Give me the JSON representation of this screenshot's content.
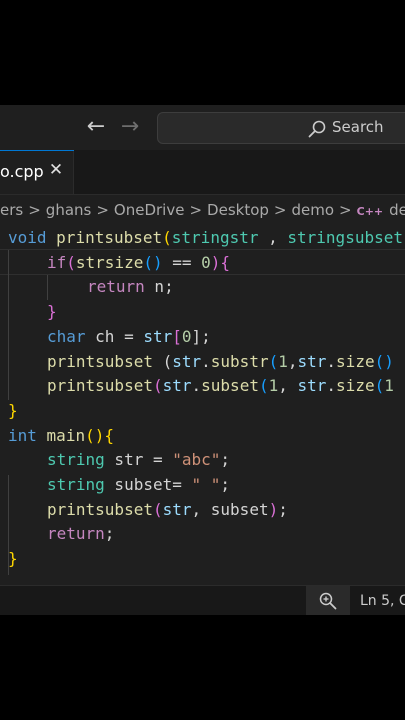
{
  "titlebar": {
    "back_icon": "arrow-left-icon",
    "forward_icon": "arrow-right-icon",
    "search_label": "Search",
    "back_glyph": "←",
    "forward_glyph": "→"
  },
  "tab": {
    "label": "o.cpp",
    "close_glyph": "✕"
  },
  "breadcrumb": {
    "parts": [
      "ers",
      "ghans",
      "OneDrive",
      "Desktop",
      "demo",
      "demo"
    ],
    "separator": ">",
    "cpp_icon_label": "C++"
  },
  "code": {
    "lines": [
      [
        [
          "void ",
          "#569cd6"
        ],
        [
          "printsubset",
          "#dcdcaa"
        ],
        [
          "(",
          "#ffd700"
        ],
        [
          "stringstr",
          "#4ec9b0"
        ],
        [
          " , ",
          "#d4d4d4"
        ],
        [
          "stringsubset",
          "#4ec9b0"
        ]
      ],
      [
        [
          "if",
          "#c586c0"
        ],
        [
          "(",
          "#da70d6"
        ],
        [
          "strsize",
          "#dcdcaa"
        ],
        [
          "()",
          "#179fff"
        ],
        [
          " == ",
          "#d4d4d4"
        ],
        [
          "0",
          "#b5cea8"
        ],
        [
          ")",
          "#da70d6"
        ],
        [
          "{",
          "#da70d6"
        ]
      ],
      [
        [
          "return",
          "#c586c0"
        ],
        [
          " n;",
          "#d4d4d4"
        ]
      ],
      [
        [
          "}",
          "#da70d6"
        ]
      ],
      [
        [
          "char",
          "#569cd6"
        ],
        [
          " ch = ",
          "#d4d4d4"
        ],
        [
          "str",
          "#9cdcfe"
        ],
        [
          "[",
          "#da70d6"
        ],
        [
          "0",
          "#b5cea8"
        ],
        [
          "];",
          "#d4d4d4"
        ]
      ],
      [
        [
          "printsubset",
          "#dcdcaa"
        ],
        [
          " (",
          "#d4d4d4"
        ],
        [
          "str",
          "#9cdcfe"
        ],
        [
          ".",
          "#d4d4d4"
        ],
        [
          "substr",
          "#dcdcaa"
        ],
        [
          "(",
          "#179fff"
        ],
        [
          "1",
          "#b5cea8"
        ],
        [
          ",",
          "#d4d4d4"
        ],
        [
          "str",
          "#9cdcfe"
        ],
        [
          ".",
          "#d4d4d4"
        ],
        [
          "size",
          "#dcdcaa"
        ],
        [
          "()",
          "#179fff"
        ]
      ],
      [
        [
          "printsubset",
          "#dcdcaa"
        ],
        [
          "(",
          "#da70d6"
        ],
        [
          "str",
          "#9cdcfe"
        ],
        [
          ".",
          "#d4d4d4"
        ],
        [
          "subset",
          "#dcdcaa"
        ],
        [
          "(",
          "#179fff"
        ],
        [
          "1",
          "#b5cea8"
        ],
        [
          ", ",
          "#d4d4d4"
        ],
        [
          "str",
          "#9cdcfe"
        ],
        [
          ".",
          "#d4d4d4"
        ],
        [
          "size",
          "#dcdcaa"
        ],
        [
          "(",
          "#179fff"
        ],
        [
          "1",
          "#b5cea8"
        ]
      ],
      [
        [
          "}",
          "#ffd700"
        ]
      ],
      [
        [
          "int",
          "#569cd6"
        ],
        [
          " ",
          "#d4d4d4"
        ],
        [
          "main",
          "#dcdcaa"
        ],
        [
          "()",
          "#ffd700"
        ],
        [
          "{",
          "#ffd700"
        ]
      ],
      [
        [
          "string",
          "#4ec9b0"
        ],
        [
          " str = ",
          "#d4d4d4"
        ],
        [
          "\"abc\"",
          "#ce9178"
        ],
        [
          ";",
          "#d4d4d4"
        ]
      ],
      [
        [
          "string",
          "#4ec9b0"
        ],
        [
          " subset= ",
          "#d4d4d4"
        ],
        [
          "\" \"",
          "#ce9178"
        ],
        [
          ";",
          "#d4d4d4"
        ]
      ],
      [
        [
          "printsubset",
          "#dcdcaa"
        ],
        [
          "(",
          "#da70d6"
        ],
        [
          "str",
          "#9cdcfe"
        ],
        [
          ", subset",
          "#d4d4d4"
        ],
        [
          ")",
          "#da70d6"
        ],
        [
          ";",
          "#d4d4d4"
        ]
      ],
      [
        [
          "return",
          "#c586c0"
        ],
        [
          ";",
          "#d4d4d4"
        ]
      ],
      [
        [
          "}",
          "#ffd700"
        ]
      ]
    ]
  },
  "status": {
    "zoom_icon": "zoom-in-icon",
    "position": "Ln 5, C"
  },
  "colors": {
    "background": "#1f1f1f",
    "accent": "#0078d4"
  }
}
